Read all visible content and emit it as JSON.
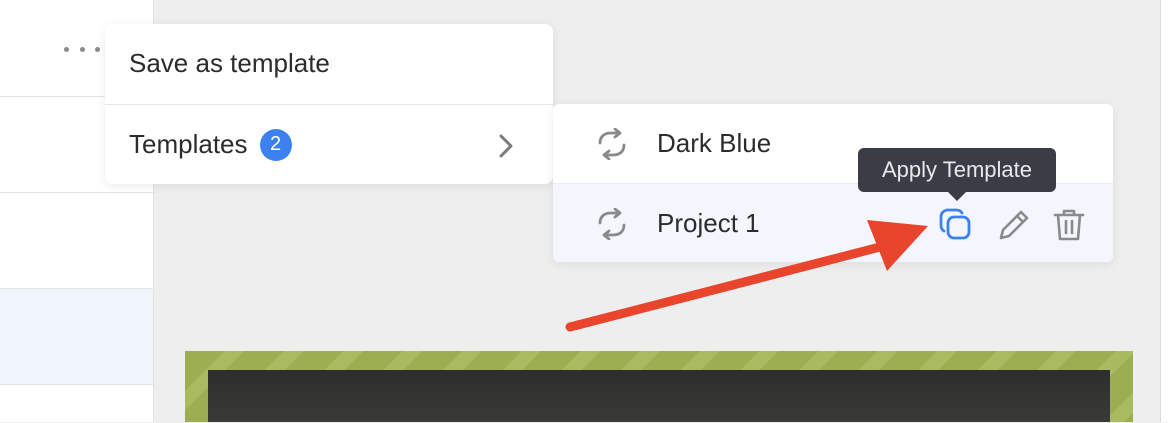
{
  "menu": {
    "save_as_template": "Save as template",
    "templates_label": "Templates",
    "templates_count": "2"
  },
  "submenu": {
    "items": [
      {
        "label": "Dark Blue",
        "icon": "sync-icon"
      },
      {
        "label": "Project 1",
        "icon": "sync-icon",
        "actions": [
          "copy-icon",
          "pencil-icon",
          "trash-icon"
        ]
      }
    ]
  },
  "tooltip": {
    "text": "Apply Template"
  },
  "colors": {
    "accent": "#3b82f0",
    "tooltip_bg": "#3a3d45",
    "annotation_arrow": "#e8452c",
    "hover_row": "#f3f7fd"
  }
}
